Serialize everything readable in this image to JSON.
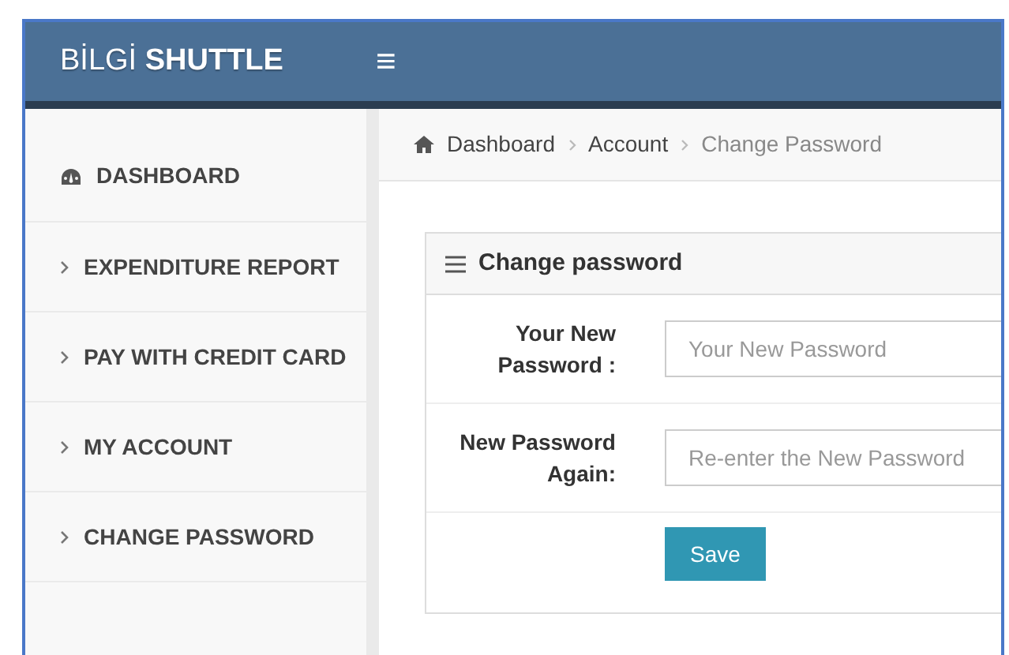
{
  "header": {
    "brand": "BİLGİ **SHUTTLE**",
    "menu_toggle": "≡"
  },
  "sidebar": {
    "items": [
      {
        "label": "DASHBOARD",
        "kind": "dashboard"
      },
      {
        "label": "EXPENDITURE REPORT",
        "kind": "submenu"
      },
      {
        "label": "PAY WITH CREDIT CARD",
        "kind": "submenu"
      },
      {
        "label": "MY ACCOUNT",
        "kind": "submenu"
      },
      {
        "label": "CHANGE PASSWORD",
        "kind": "submenu"
      }
    ]
  },
  "breadcrumb": [
    {
      "label": "Dashboard",
      "kind": "home"
    },
    {
      "label": "Account",
      "kind": "link"
    },
    {
      "label": "Change Password",
      "kind": "current"
    }
  ],
  "panel": {
    "title": "Change password",
    "fields": [
      {
        "label": "Your New Password :",
        "placeholder": "Your New Password"
      },
      {
        "label": "New Password Again:",
        "placeholder": "Re-enter the New Password"
      }
    ],
    "button": "Save"
  }
}
